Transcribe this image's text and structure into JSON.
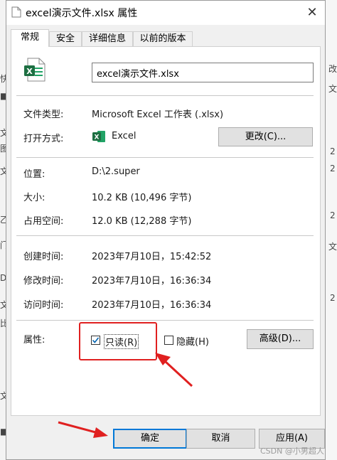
{
  "window": {
    "title": "excel演示文件.xlsx 属性",
    "close_glyph": "✕"
  },
  "tabs": [
    "常规",
    "安全",
    "详细信息",
    "以前的版本"
  ],
  "file_name": "excel演示文件.xlsx",
  "props": {
    "type_label": "文件类型:",
    "type_value": "Microsoft Excel 工作表 (.xlsx)",
    "open_with_label": "打开方式:",
    "open_with_value": "Excel",
    "change_button": "更改(C)...",
    "location_label": "位置:",
    "location_value": "D:\\2.super",
    "size_label": "大小:",
    "size_value": "10.2 KB (10,496 字节)",
    "disk_size_label": "占用空间:",
    "disk_size_value": "12.0 KB (12,288 字节)",
    "created_label": "创建时间:",
    "created_value": "2023年7月10日，15:42:52",
    "modified_label": "修改时间:",
    "modified_value": "2023年7月10日，16:36:34",
    "accessed_label": "访问时间:",
    "accessed_value": "2023年7月10日，16:36:34",
    "attributes_label": "属性:",
    "readonly_label": "只读(R)",
    "readonly_checked": true,
    "hidden_label": "隐藏(H)",
    "hidden_checked": false,
    "advanced_button": "高级(D)..."
  },
  "footer": {
    "ok": "确定",
    "cancel": "取消",
    "apply": "应用(A)"
  },
  "watermark": "CSDN @小男超人",
  "background_chars": {
    "left": [
      "快",
      "■",
      "文",
      "图",
      "文",
      "乙",
      "门",
      "D",
      "文",
      "比",
      "文",
      "■"
    ],
    "right": [
      "改",
      "文",
      "2",
      "2",
      "2",
      "文",
      "2"
    ]
  },
  "colors": {
    "excel_green": "#1d6f42",
    "highlight_red": "#e02020",
    "ok_focus_blue": "#0078d7"
  },
  "icons": {
    "title": "document-icon",
    "file": "excel-file-icon",
    "app": "excel-app-icon",
    "arrow": "red-arrow-annotation"
  }
}
